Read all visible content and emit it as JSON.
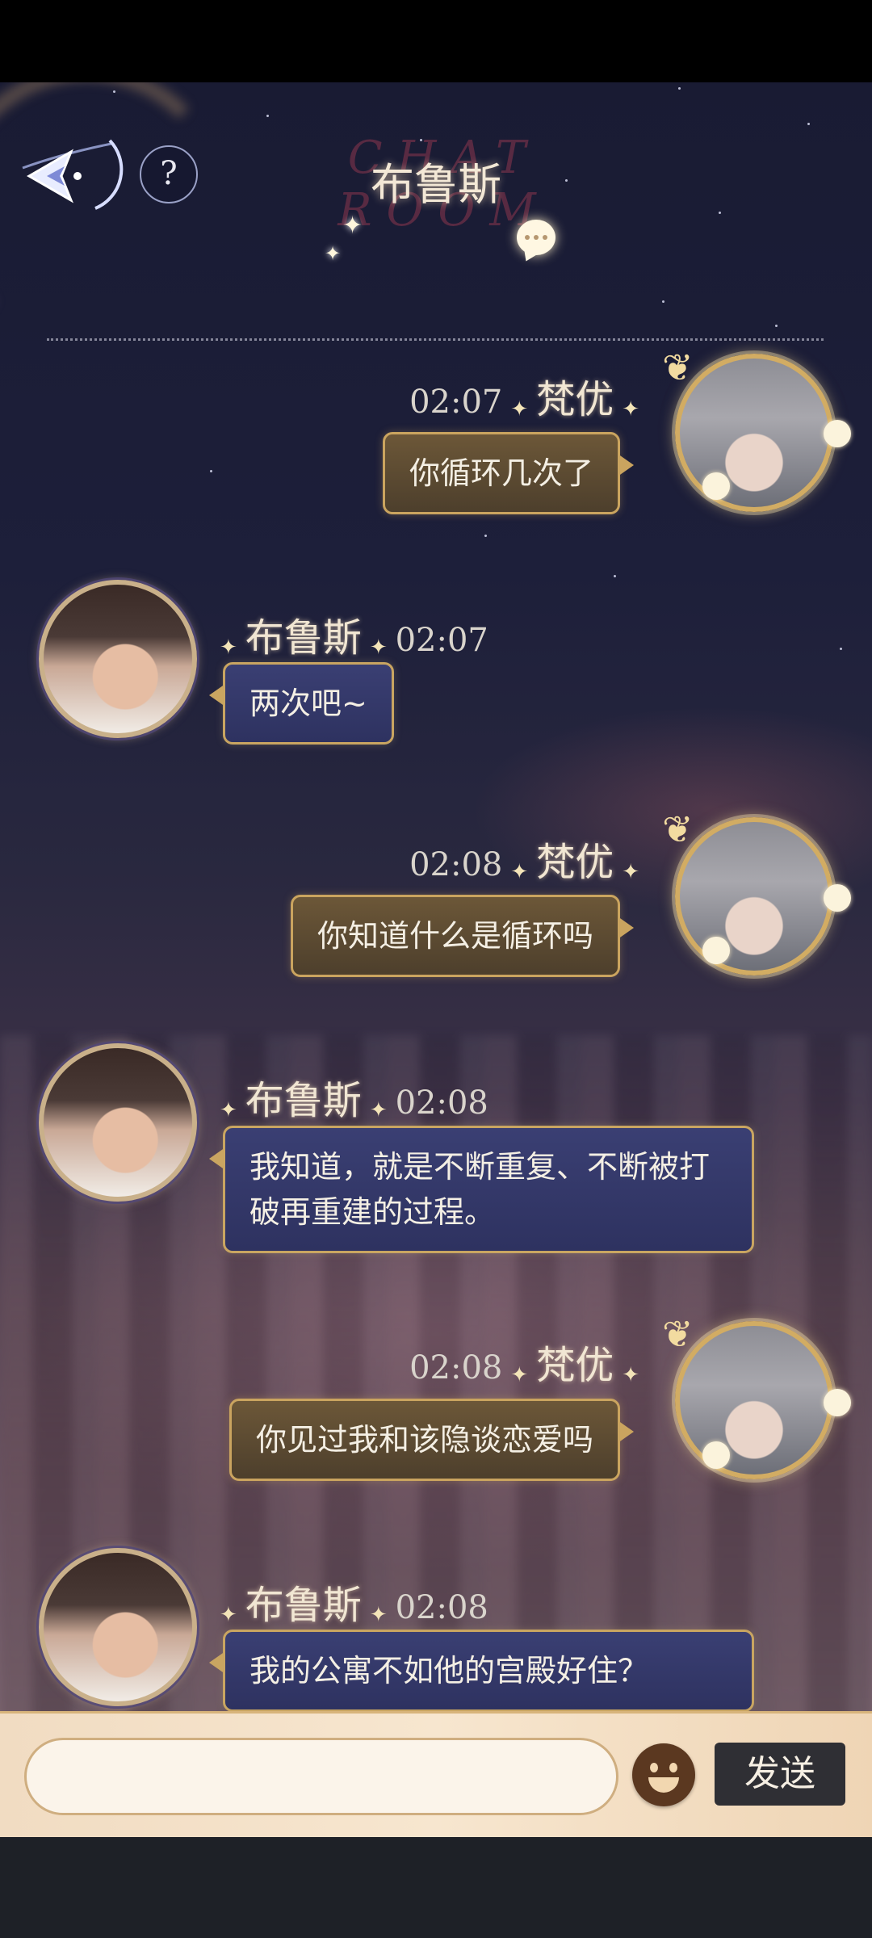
{
  "header": {
    "watermark": "CHAT ROOM",
    "title": "布鲁斯",
    "help_label": "?"
  },
  "messages": [
    {
      "side": "right",
      "name": "梵优",
      "time": "02:07",
      "text": "你循环几次了"
    },
    {
      "side": "left",
      "name": "布鲁斯",
      "time": "02:07",
      "text": "两次吧~"
    },
    {
      "side": "right",
      "name": "梵优",
      "time": "02:08",
      "text": "你知道什么是循环吗"
    },
    {
      "side": "left",
      "name": "布鲁斯",
      "time": "02:08",
      "text": "我知道，就是不断重复、不断被打破再重建的过程。"
    },
    {
      "side": "right",
      "name": "梵优",
      "time": "02:08",
      "text": "你见过我和该隐谈恋爱吗"
    },
    {
      "side": "left",
      "name": "布鲁斯",
      "time": "02:08",
      "text": "我的公寓不如他的宫殿好住？"
    }
  ],
  "input_bar": {
    "placeholder": "",
    "value": "",
    "emoji_icon": "smiley-face-icon",
    "send_label": "发送"
  },
  "icons": {
    "back": "back-arrow-icon",
    "help": "question-mark-icon",
    "chat": "speech-bubble-icon"
  }
}
